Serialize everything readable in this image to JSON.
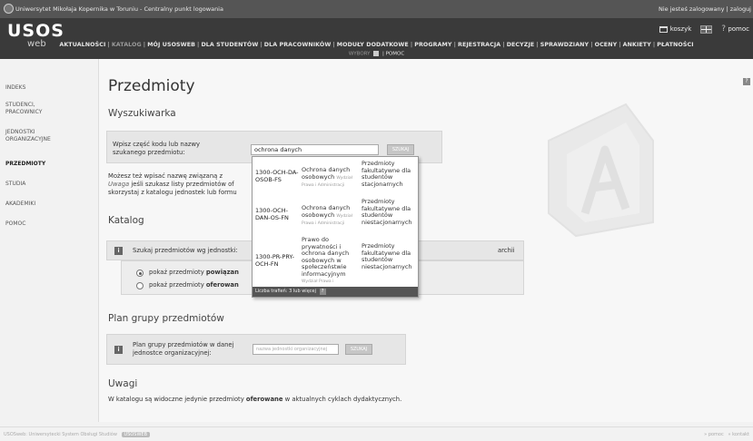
{
  "topbar": {
    "university": "Uniwersytet Mikołaja Kopernika w Toruniu - Centralny punkt logowania",
    "login_status": "Nie jesteś zalogowany | zaloguj"
  },
  "header": {
    "logo_main": "USOS",
    "logo_sub": "web",
    "cart_label": "koszyk",
    "help_label": "pomoc"
  },
  "nav": {
    "items": [
      "AKTUALNOŚCI",
      "KATALOG",
      "MÓJ USOSWEB",
      "DLA STUDENTÓW",
      "DLA PRACOWNIKÓW",
      "MODUŁY DODATKOWE",
      "PROGRAMY",
      "REJESTRACJA",
      "DECYZJE",
      "SPRAWDZIANY",
      "OCENY",
      "ANKIETY",
      "PŁATNOŚCI"
    ],
    "active": "KATALOG",
    "sub_items": [
      "WYBORY",
      "POMOC"
    ]
  },
  "sidebar": {
    "items": [
      {
        "label": "INDEKS",
        "active": false
      },
      {
        "label": "STUDENCI,\nPRACOWNICY",
        "active": false
      },
      {
        "label": "JEDNOSTKI\nORGANIZACYJNE",
        "active": false
      },
      {
        "label": "PRZEDMIOTY",
        "active": true
      },
      {
        "label": "STUDIA",
        "active": false
      },
      {
        "label": "AKADEMIKI",
        "active": false
      },
      {
        "label": "POMOC",
        "active": false
      }
    ]
  },
  "main": {
    "title": "Przedmioty",
    "search_section": "Wyszukiwarka",
    "search_label": "Wpisz część kodu lub nazwy szukanego przedmiotu:",
    "search_value": "ochrona danych",
    "search_button": "SZUKAJ",
    "hint_line1": "Możesz też wpisać nazwę związaną z",
    "hint_uwaga": "Uwaga",
    "hint_line2": " jeśli szukasz listy przedmiotów of",
    "hint_line3": "skorzystaj z katalogu jednostek lub formu",
    "catalog_section": "Katalog",
    "catalog_label": "Szukaj przedmiotów wg jednostki:",
    "catalog_tail": "archii",
    "radio1_prefix": "pokaż przedmioty ",
    "radio1_bold": "powiązan",
    "radio2_prefix": "pokaż przedmioty ",
    "radio2_bold": "oferowan",
    "plan_section": "Plan grupy przedmiotów",
    "plan_label": "Plan grupy przedmiotów w danej jednostce organizacyjnej:",
    "plan_placeholder": "nazwa jednostki organizacyjnej",
    "plan_button": "SZUKAJ",
    "notes_section": "Uwagi",
    "notes_pre": "W katalogu są widoczne jedynie przedmioty ",
    "notes_bold": "oferowane",
    "notes_post": " w aktualnych cyklach dydaktycznych."
  },
  "dropdown": {
    "results": [
      {
        "code": "1300-OCH-DA-OSOB-FS",
        "name": "Ochrona danych osobowych",
        "faculty": "Wydział Prawa i Administracji",
        "type": "Przedmioty fakultatywne dla studentów stacjonarnych"
      },
      {
        "code": "1300-OCH-DAN-OS-FN",
        "name": "Ochrona danych osobowych",
        "faculty": "Wydział Prawa i Administracji",
        "type": "Przedmioty fakultatywne dla studentów niestacjonarnych"
      },
      {
        "code": "1300-PR-PRY-OCH-FN",
        "name": "Prawo do prywatności i ochrona danych osobowych w społeczeństwie informacyjnym",
        "faculty": "Wydział Prawa i Administracji",
        "type": "Przedmioty fakultatywne dla studentów niestacjonarnych"
      }
    ],
    "footer": "Liczba trafień: 3 lub więcej",
    "footer_help": "?"
  },
  "footer": {
    "left": "USOSweb: Uniwersytecki System Obsługi Studiów",
    "badge": "USOSWEB",
    "right_pomoc": "pomoc",
    "right_kontakt": "kontakt"
  }
}
